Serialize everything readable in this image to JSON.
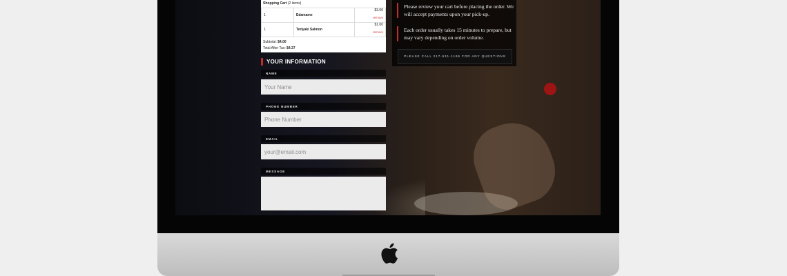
{
  "cart": {
    "title": "Shopping Cart",
    "count": "(2 items)",
    "items": [
      {
        "qty": "1",
        "name": "Edamame",
        "price": "$3.00",
        "remove": "remove"
      },
      {
        "qty": "1",
        "name": "Teriyaki Salmon",
        "price": "$1.00",
        "remove": "remove"
      }
    ],
    "subtotal_label": "Subtotal:",
    "subtotal_value": "$4.00",
    "total_label": "Total After Tax:",
    "total_value": "$4.37"
  },
  "form": {
    "title": "YOUR INFORMATION",
    "name_label": "NAME",
    "name_placeholder": "Your Name",
    "phone_label": "PHONE NUMBER",
    "phone_placeholder": "Phone Number",
    "email_label": "EMAIL",
    "email_placeholder": "your@email.com",
    "message_label": "MESSAGE",
    "message_placeholder": ""
  },
  "info": {
    "note1": "Please review your cart before placing the order. We will accept payments upon your pick-up.",
    "note2": "Each order usually takes 15 minutes to prepare, but may vary depending on order volume.",
    "call_button": "PLEASE CALL 217-531-1186 FOR ANY QUESTIONS"
  },
  "icons": {
    "logo": "apple-logo-icon"
  },
  "colors": {
    "accent": "#c42b2b",
    "remove_link": "#d23b3b",
    "field_bg": "#ebebeb"
  }
}
